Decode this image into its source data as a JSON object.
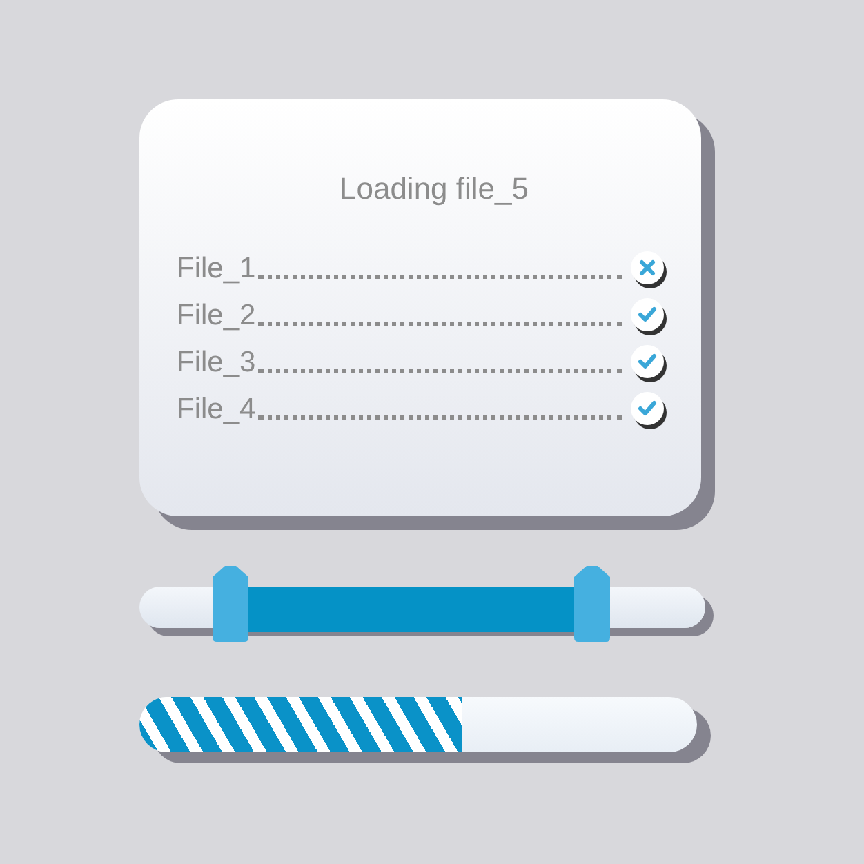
{
  "dialog": {
    "title": "Loading file_5",
    "files": [
      {
        "name": "File_1",
        "done": false
      },
      {
        "name": "File_2",
        "done": true
      },
      {
        "name": "File_3",
        "done": true
      },
      {
        "name": "File_4",
        "done": true
      }
    ]
  },
  "range_slider": {
    "handles": [
      {
        "level": 0.16
      },
      {
        "level": 0.8
      }
    ]
  },
  "progress_bar": {
    "level": 0.58
  }
}
